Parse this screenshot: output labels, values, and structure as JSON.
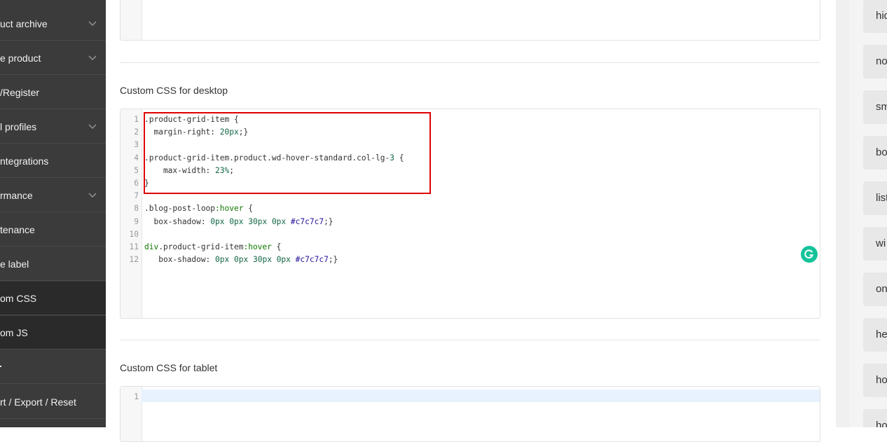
{
  "sidebar": {
    "items": [
      {
        "label": "uct archive",
        "chevron": true,
        "active": false
      },
      {
        "label": "e product",
        "chevron": true,
        "active": false
      },
      {
        "label": "/Register",
        "chevron": false,
        "active": false
      },
      {
        "label": "l profiles",
        "chevron": true,
        "active": false
      },
      {
        "label": "ntegrations",
        "chevron": false,
        "active": false
      },
      {
        "label": "rmance",
        "chevron": true,
        "active": false
      },
      {
        "label": "tenance",
        "chevron": false,
        "active": false
      },
      {
        "label": "e label",
        "chevron": false,
        "active": false
      },
      {
        "label": "om CSS",
        "chevron": false,
        "active": true
      },
      {
        "label": "om JS",
        "chevron": false,
        "active": true
      },
      {
        "label": "",
        "chevron": false,
        "active": false
      },
      {
        "label": "rt / Export / Reset",
        "chevron": false,
        "active": false
      }
    ]
  },
  "sections": {
    "desktop_title": "Custom CSS for desktop",
    "tablet_title": "Custom CSS for tablet"
  },
  "desktop_code": [
    {
      "n": "1",
      "t": ".product-grid-item {"
    },
    {
      "n": "2",
      "t": "  margin-right: 20px;}"
    },
    {
      "n": "3",
      "t": ""
    },
    {
      "n": "4",
      "t": ".product-grid-item.product.wd-hover-standard.col-lg-3 {"
    },
    {
      "n": "5",
      "t": "    max-width: 23%;"
    },
    {
      "n": "6",
      "t": "}"
    },
    {
      "n": "7",
      "t": ""
    },
    {
      "n": "8",
      "t": ".blog-post-loop:hover {"
    },
    {
      "n": "9",
      "t": "  box-shadow: 0px 0px 30px 0px #c7c7c7;}"
    },
    {
      "n": "10",
      "t": ""
    },
    {
      "n": "11",
      "t": "div.product-grid-item:hover {"
    },
    {
      "n": "12",
      "t": "   box-shadow: 0px 0px 30px 0px #c7c7c7;}"
    }
  ],
  "tablet_code": [
    {
      "n": "1",
      "t": ""
    }
  ],
  "right_panel": {
    "chips": [
      "hid",
      "no",
      "sm",
      "bo",
      "list",
      "wi",
      "on",
      "he",
      "ho",
      "ho"
    ]
  },
  "colors": {
    "sidebar_bg": "#3b3b3b",
    "sidebar_active_bg": "#2a2a2a",
    "highlight_border": "#e00000",
    "grammarly": "#15c39a"
  }
}
